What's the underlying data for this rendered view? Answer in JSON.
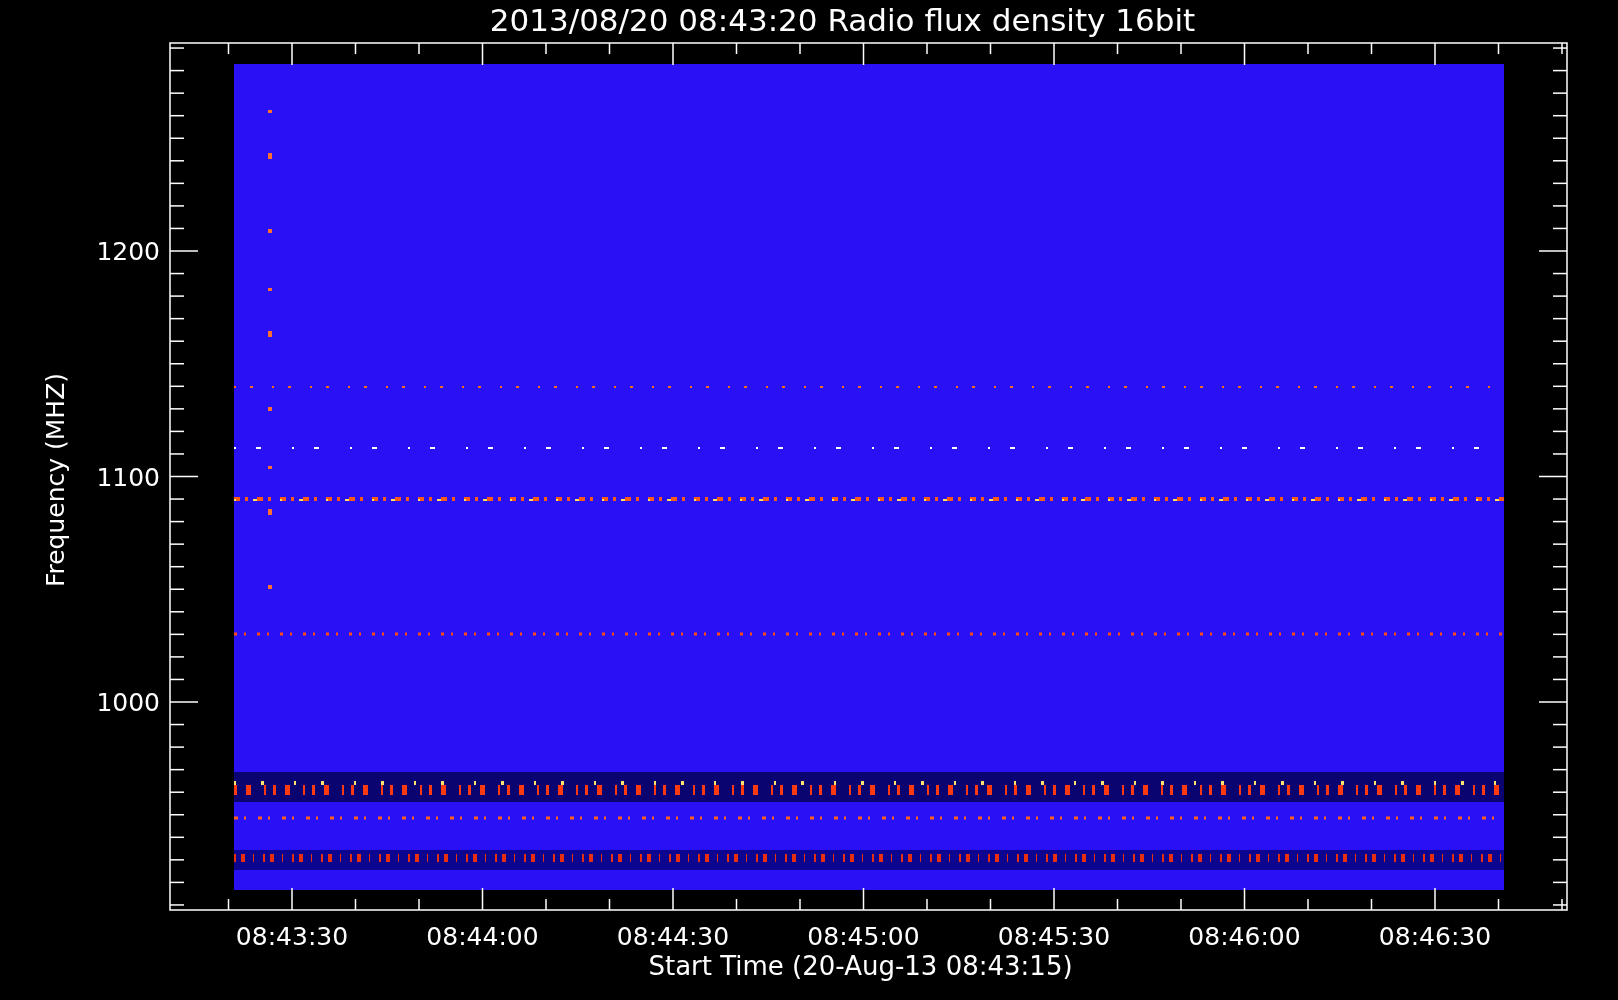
{
  "title": "2013/08/20 08:43:20 Radio flux density 16bit",
  "ylabel": "Frequency (MHZ)",
  "yticks": [
    "1200",
    "1100",
    "1000"
  ],
  "xlabel": "Start Time (20-Aug-13 08:43:15)",
  "xticks": [
    "08:43:30",
    "08:44:00",
    "08:44:30",
    "08:45:00",
    "08:45:30",
    "08:46:00",
    "08:46:30"
  ]
}
